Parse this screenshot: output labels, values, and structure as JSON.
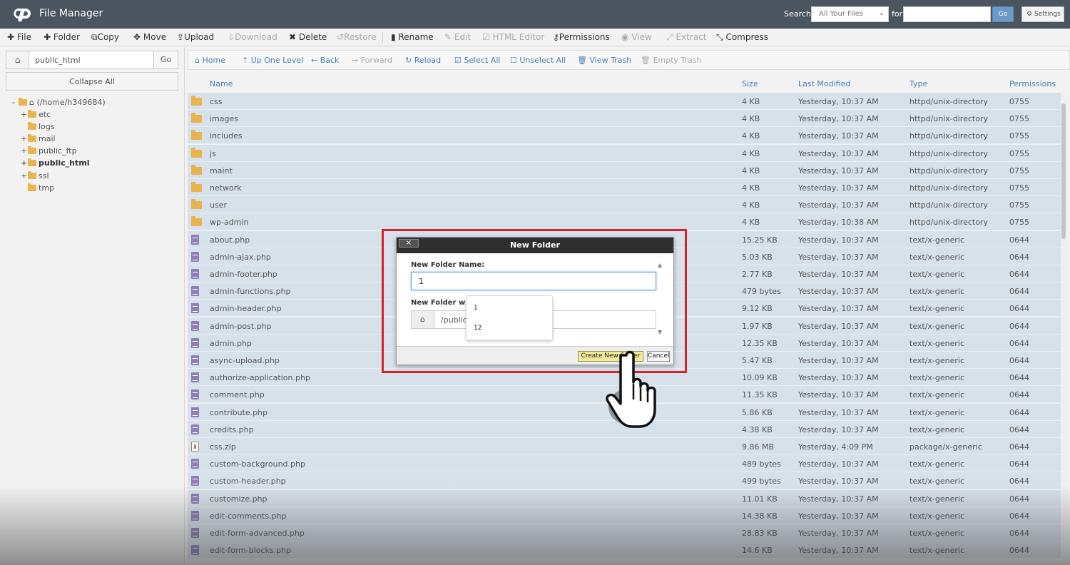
{
  "app": {
    "title": "File Manager"
  },
  "search": {
    "label": "Search",
    "scope": "All Your Files",
    "for_label": "for",
    "go": "Go",
    "settings": "Settings"
  },
  "toolbar": {
    "file": "File",
    "folder": "Folder",
    "copy": "Copy",
    "move": "Move",
    "upload": "Upload",
    "download": "Download",
    "delete": "Delete",
    "restore": "Restore",
    "rename": "Rename",
    "edit": "Edit",
    "html_editor": "HTML Editor",
    "permissions": "Permissions",
    "view": "View",
    "extract": "Extract",
    "compress": "Compress"
  },
  "left": {
    "path_value": "public_html",
    "go": "Go",
    "collapse": "Collapse All",
    "tree": {
      "root": "(/home/h349684)",
      "items": [
        "etc",
        "logs",
        "mail",
        "public_ftp",
        "public_html",
        "ssl",
        "tmp"
      ]
    }
  },
  "navbar": {
    "home": "Home",
    "up": "Up One Level",
    "back": "Back",
    "forward": "Forward",
    "reload": "Reload",
    "select_all": "Select All",
    "unselect_all": "Unselect All",
    "view_trash": "View Trash",
    "empty_trash": "Empty Trash"
  },
  "table": {
    "headers": {
      "name": "Name",
      "size": "Size",
      "modified": "Last Modified",
      "type": "Type",
      "perms": "Permissions"
    },
    "rows": [
      {
        "icon": "folder",
        "name": "css",
        "size": "4 KB",
        "modified": "Yesterday, 10:37 AM",
        "type": "httpd/unix-directory",
        "perms": "0755"
      },
      {
        "icon": "folder",
        "name": "images",
        "size": "4 KB",
        "modified": "Yesterday, 10:37 AM",
        "type": "httpd/unix-directory",
        "perms": "0755"
      },
      {
        "icon": "folder",
        "name": "includes",
        "size": "4 KB",
        "modified": "Yesterday, 10:37 AM",
        "type": "httpd/unix-directory",
        "perms": "0755"
      },
      {
        "icon": "folder",
        "name": "js",
        "size": "4 KB",
        "modified": "Yesterday, 10:37 AM",
        "type": "httpd/unix-directory",
        "perms": "0755"
      },
      {
        "icon": "folder",
        "name": "maint",
        "size": "4 KB",
        "modified": "Yesterday, 10:37 AM",
        "type": "httpd/unix-directory",
        "perms": "0755"
      },
      {
        "icon": "folder",
        "name": "network",
        "size": "4 KB",
        "modified": "Yesterday, 10:37 AM",
        "type": "httpd/unix-directory",
        "perms": "0755"
      },
      {
        "icon": "folder",
        "name": "user",
        "size": "4 KB",
        "modified": "Yesterday, 10:37 AM",
        "type": "httpd/unix-directory",
        "perms": "0755"
      },
      {
        "icon": "folder",
        "name": "wp-admin",
        "size": "4 KB",
        "modified": "Yesterday, 10:38 AM",
        "type": "httpd/unix-directory",
        "perms": "0755"
      },
      {
        "icon": "file",
        "name": "about.php",
        "size": "15.25 KB",
        "modified": "Yesterday, 10:37 AM",
        "type": "text/x-generic",
        "perms": "0644"
      },
      {
        "icon": "file",
        "name": "admin-ajax.php",
        "size": "5.03 KB",
        "modified": "Yesterday, 10:37 AM",
        "type": "text/x-generic",
        "perms": "0644"
      },
      {
        "icon": "file",
        "name": "admin-footer.php",
        "size": "2.77 KB",
        "modified": "Yesterday, 10:37 AM",
        "type": "text/x-generic",
        "perms": "0644"
      },
      {
        "icon": "file",
        "name": "admin-functions.php",
        "size": "479 bytes",
        "modified": "Yesterday, 10:37 AM",
        "type": "text/x-generic",
        "perms": "0644"
      },
      {
        "icon": "file",
        "name": "admin-header.php",
        "size": "9.12 KB",
        "modified": "Yesterday, 10:37 AM",
        "type": "text/x-generic",
        "perms": "0644"
      },
      {
        "icon": "file",
        "name": "admin-post.php",
        "size": "1.97 KB",
        "modified": "Yesterday, 10:37 AM",
        "type": "text/x-generic",
        "perms": "0644"
      },
      {
        "icon": "file",
        "name": "admin.php",
        "size": "12.35 KB",
        "modified": "Yesterday, 10:37 AM",
        "type": "text/x-generic",
        "perms": "0644"
      },
      {
        "icon": "file",
        "name": "async-upload.php",
        "size": "5.47 KB",
        "modified": "Yesterday, 10:37 AM",
        "type": "text/x-generic",
        "perms": "0644"
      },
      {
        "icon": "file",
        "name": "authorize-application.php",
        "size": "10.09 KB",
        "modified": "Yesterday, 10:37 AM",
        "type": "text/x-generic",
        "perms": "0644"
      },
      {
        "icon": "file",
        "name": "comment.php",
        "size": "11.35 KB",
        "modified": "Yesterday, 10:37 AM",
        "type": "text/x-generic",
        "perms": "0644"
      },
      {
        "icon": "file",
        "name": "contribute.php",
        "size": "5.86 KB",
        "modified": "Yesterday, 10:37 AM",
        "type": "text/x-generic",
        "perms": "0644"
      },
      {
        "icon": "file",
        "name": "credits.php",
        "size": "4.38 KB",
        "modified": "Yesterday, 10:37 AM",
        "type": "text/x-generic",
        "perms": "0644"
      },
      {
        "icon": "zip",
        "name": "css.zip",
        "size": "9.86 MB",
        "modified": "Yesterday, 4:09 PM",
        "type": "package/x-generic",
        "perms": "0644"
      },
      {
        "icon": "file",
        "name": "custom-background.php",
        "size": "489 bytes",
        "modified": "Yesterday, 10:37 AM",
        "type": "text/x-generic",
        "perms": "0644"
      },
      {
        "icon": "file",
        "name": "custom-header.php",
        "size": "499 bytes",
        "modified": "Yesterday, 10:37 AM",
        "type": "text/x-generic",
        "perms": "0644"
      },
      {
        "icon": "file",
        "name": "customize.php",
        "size": "11.01 KB",
        "modified": "Yesterday, 10:37 AM",
        "type": "text/x-generic",
        "perms": "0644"
      },
      {
        "icon": "file",
        "name": "edit-comments.php",
        "size": "14.38 KB",
        "modified": "Yesterday, 10:37 AM",
        "type": "text/x-generic",
        "perms": "0644"
      },
      {
        "icon": "file",
        "name": "edit-form-advanced.php",
        "size": "28.83 KB",
        "modified": "Yesterday, 10:37 AM",
        "type": "text/x-generic",
        "perms": "0644"
      },
      {
        "icon": "file",
        "name": "edit-form-blocks.php",
        "size": "14.6 KB",
        "modified": "Yesterday, 10:37 AM",
        "type": "text/x-generic",
        "perms": "0644"
      }
    ]
  },
  "dialog": {
    "title": "New Folder",
    "close": "×",
    "name_label": "New Folder Name:",
    "name_value": "1",
    "location_label": "New Folder will be",
    "location_value": "/public_",
    "create": "Create New Folder",
    "cancel": "Cancel",
    "suggestions": [
      "1",
      "12"
    ]
  },
  "colors": {
    "topbar": "#4a5560",
    "row_selected": "#d7e1ea",
    "link": "#4a7fb5",
    "highlight": "#d6202a",
    "create_button": "#f0eb9a"
  }
}
